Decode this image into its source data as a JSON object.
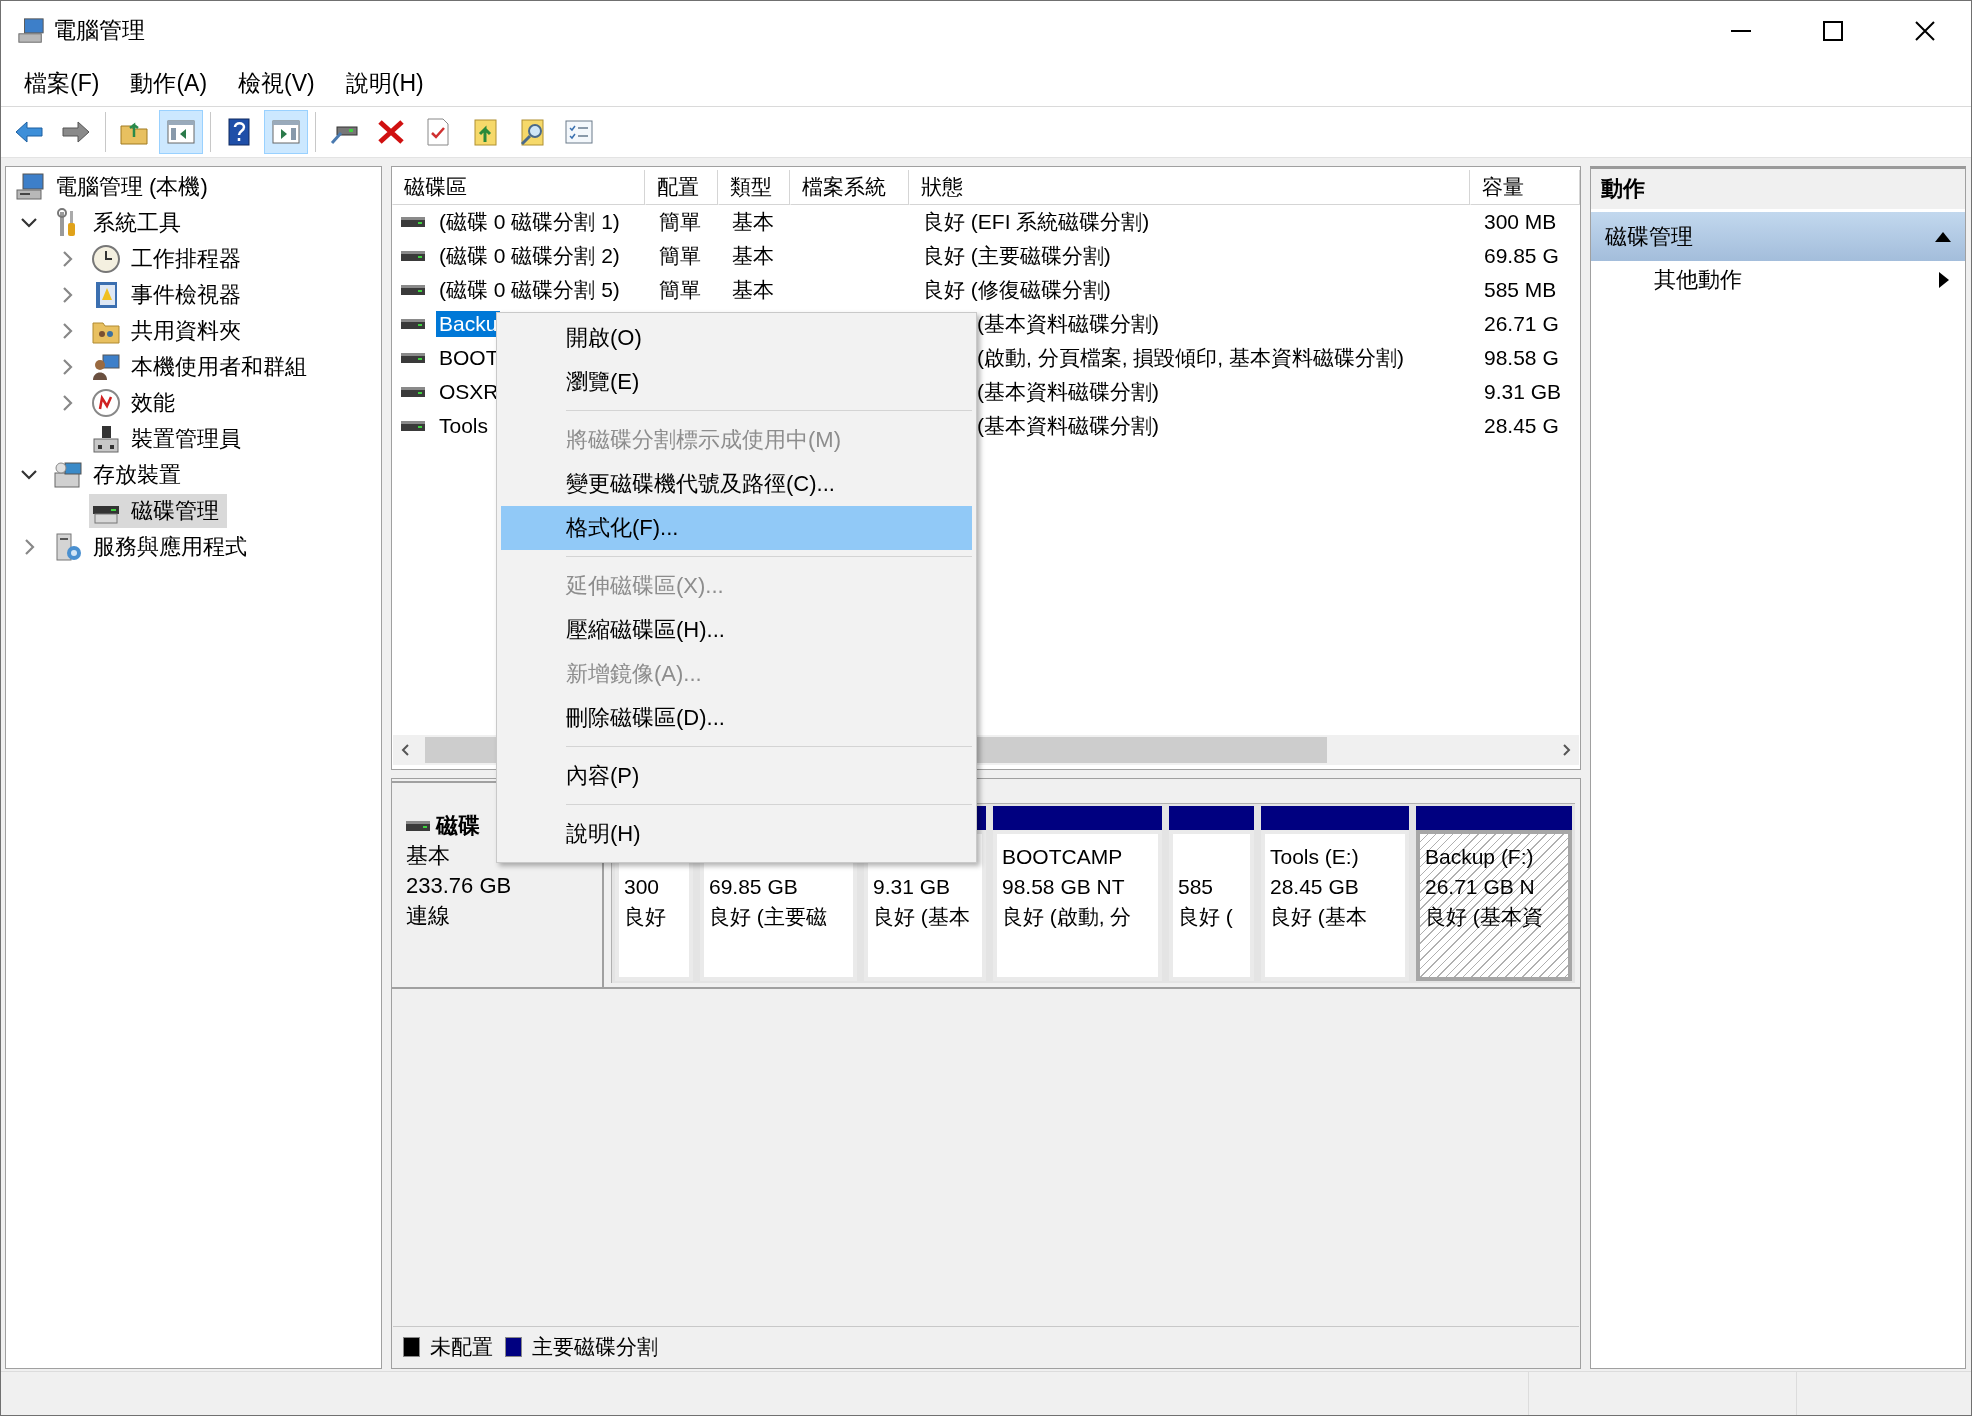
{
  "window": {
    "title": "電腦管理"
  },
  "menu_bar": [
    "檔案(F)",
    "動作(A)",
    "檢視(V)",
    "說明(H)"
  ],
  "toolbar": [
    {
      "kind": "button",
      "pressed": false
    },
    {
      "kind": "button",
      "pressed": false
    },
    {
      "kind": "separator"
    },
    {
      "kind": "button",
      "pressed": false
    },
    {
      "kind": "button",
      "pressed": true
    },
    {
      "kind": "separator"
    },
    {
      "kind": "button",
      "pressed": false
    },
    {
      "kind": "button",
      "pressed": true
    },
    {
      "kind": "separator"
    },
    {
      "kind": "button",
      "pressed": false
    },
    {
      "kind": "button",
      "pressed": false
    },
    {
      "kind": "button",
      "pressed": false
    },
    {
      "kind": "button",
      "pressed": false
    },
    {
      "kind": "button",
      "pressed": false
    },
    {
      "kind": "button",
      "pressed": false
    }
  ],
  "tree": [
    {
      "label": "電腦管理 (本機)",
      "selected": false,
      "children": [
        {
          "label": "系統工具",
          "expanded": true,
          "selected": false,
          "children": [
            {
              "label": "工作排程器",
              "expanded": false,
              "selected": false
            },
            {
              "label": "事件檢視器",
              "expanded": false,
              "selected": false
            },
            {
              "label": "共用資料夾",
              "expanded": false,
              "selected": false
            },
            {
              "label": "本機使用者和群組",
              "expanded": false,
              "selected": false
            },
            {
              "label": "效能",
              "expanded": false,
              "selected": false
            },
            {
              "label": "裝置管理員",
              "selected": false
            }
          ]
        },
        {
          "label": "存放裝置",
          "expanded": true,
          "selected": false,
          "children": [
            {
              "label": "磁碟管理",
              "selected": true
            }
          ]
        },
        {
          "label": "服務與應用程式",
          "expanded": false,
          "selected": false
        }
      ]
    }
  ],
  "volume_table": {
    "columns": [
      "磁碟區",
      "配置",
      "類型",
      "檔案系統",
      "狀態",
      "容量"
    ],
    "rows": [
      {
        "volume": "(磁碟 0 磁碟分割 1)",
        "layout": "簡單",
        "type": "基本",
        "status": "良好 (EFI 系統磁碟分割)",
        "capacity": "300 MB",
        "selected": false
      },
      {
        "volume": "(磁碟 0 磁碟分割 2)",
        "layout": "簡單",
        "type": "基本",
        "status": "良好 (主要磁碟分割)",
        "capacity": "69.85 G",
        "selected": false
      },
      {
        "volume": "(磁碟 0 磁碟分割 5)",
        "layout": "簡單",
        "type": "基本",
        "status": "良好 (修復磁碟分割)",
        "capacity": "585 MB",
        "selected": false
      },
      {
        "volume": "Backu",
        "status": "(基本資料磁碟分割)",
        "capacity": "26.71 G",
        "selected": true
      },
      {
        "volume": "BOOT",
        "status": "(啟動, 分頁檔案, 損毀傾印, 基本資料磁碟分割)",
        "capacity": "98.58 G",
        "selected": false
      },
      {
        "volume": "OSXR",
        "status": "(基本資料磁碟分割)",
        "capacity": "9.31 GB",
        "selected": false
      },
      {
        "volume": "Tools",
        "status": "(基本資料磁碟分割)",
        "capacity": "28.45 G",
        "selected": false
      }
    ]
  },
  "disk_map": {
    "disk": {
      "name": "磁碟",
      "type": "基本",
      "size": "233.76 GB",
      "state": "連線"
    },
    "partitions": [
      {
        "size": "300",
        "status": "良好",
        "selected": false
      },
      {
        "size": "69.85 GB",
        "status": "良好 (主要磁",
        "selected": false
      },
      {
        "size": "9.31 GB",
        "status": "良好 (基本",
        "selected": false
      },
      {
        "name": "BOOTCAMP",
        "size": "98.58 GB NT",
        "status": "良好 (啟動, 分",
        "selected": false
      },
      {
        "size": "585",
        "status": "良好 (",
        "selected": false
      },
      {
        "name": "Tools  (E:)",
        "size": "28.45 GB",
        "status": "良好 (基本",
        "selected": false
      },
      {
        "name": "Backup  (F:)",
        "size": "26.71 GB N",
        "status": "良好 (基本資",
        "selected": true
      }
    ],
    "legend": [
      {
        "label": "未配置",
        "color": "#000000"
      },
      {
        "label": "主要磁碟分割",
        "color": "#000080"
      }
    ]
  },
  "context_menu": [
    {
      "kind": "item",
      "label": "開啟(O)",
      "disabled": false,
      "selected": false
    },
    {
      "kind": "item",
      "label": "瀏覽(E)",
      "disabled": false,
      "selected": false
    },
    {
      "kind": "separator"
    },
    {
      "kind": "item",
      "label": "將磁碟分割標示成使用中(M)",
      "disabled": true,
      "selected": false
    },
    {
      "kind": "item",
      "label": "變更磁碟機代號及路徑(C)...",
      "disabled": false,
      "selected": false
    },
    {
      "kind": "item",
      "label": "格式化(F)...",
      "disabled": false,
      "selected": true
    },
    {
      "kind": "separator"
    },
    {
      "kind": "item",
      "label": "延伸磁碟區(X)...",
      "disabled": true,
      "selected": false
    },
    {
      "kind": "item",
      "label": "壓縮磁碟區(H)...",
      "disabled": false,
      "selected": false
    },
    {
      "kind": "item",
      "label": "新增鏡像(A)...",
      "disabled": true,
      "selected": false
    },
    {
      "kind": "item",
      "label": "刪除磁碟區(D)...",
      "disabled": false,
      "selected": false
    },
    {
      "kind": "separator"
    },
    {
      "kind": "item",
      "label": "內容(P)",
      "disabled": false,
      "selected": false
    },
    {
      "kind": "separator"
    },
    {
      "kind": "item",
      "label": "說明(H)",
      "disabled": false,
      "selected": false
    }
  ],
  "actions_pane": {
    "title": "動作",
    "sections": [
      {
        "label": "磁碟管理",
        "expanded": true,
        "items": [
          "其他動作"
        ]
      }
    ]
  }
}
